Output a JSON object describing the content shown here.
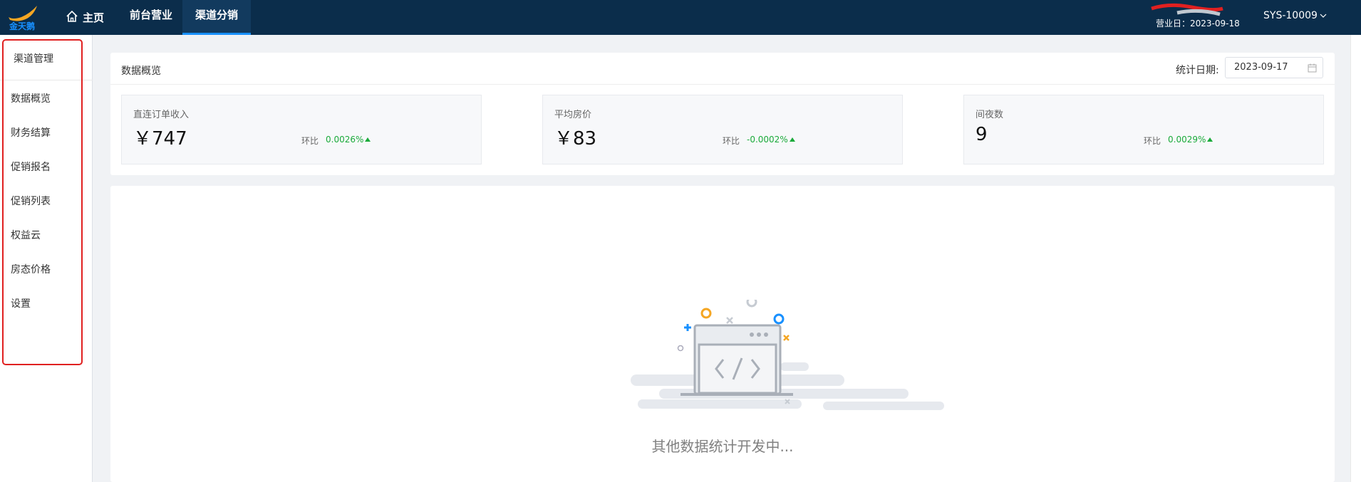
{
  "topbar": {
    "logo_text": "金天鹅",
    "nav": [
      {
        "label": "主页"
      },
      {
        "label": "前台营业"
      },
      {
        "label": "渠道分销"
      }
    ],
    "business_day_label": "营业日：",
    "business_day": "2023-09-18",
    "user": "SYS-10009"
  },
  "sidebar": {
    "title": "渠道管理",
    "items": [
      {
        "label": "数据概览"
      },
      {
        "label": "财务结算"
      },
      {
        "label": "促销报名"
      },
      {
        "label": "促销列表"
      },
      {
        "label": "权益云"
      },
      {
        "label": "房态价格"
      },
      {
        "label": "设置"
      }
    ]
  },
  "overview": {
    "title": "数据概览",
    "date_label": "统计日期:",
    "date_value": "2023-09-17",
    "stats": [
      {
        "label": "直连订单收入",
        "value": "￥747",
        "ratio_label": "环比",
        "ratio": "0.0026%"
      },
      {
        "label": "平均房价",
        "value": "￥83",
        "ratio_label": "环比",
        "ratio": "-0.0002%"
      },
      {
        "label": "间夜数",
        "value": "9",
        "ratio_label": "环比",
        "ratio": "0.0029%"
      }
    ]
  },
  "empty_state": {
    "text": "其他数据统计开发中..."
  },
  "colors": {
    "topbar": "#0b2d4b",
    "accent": "#1890ff",
    "positive": "#1aaa3a",
    "outline": "#e02020"
  }
}
